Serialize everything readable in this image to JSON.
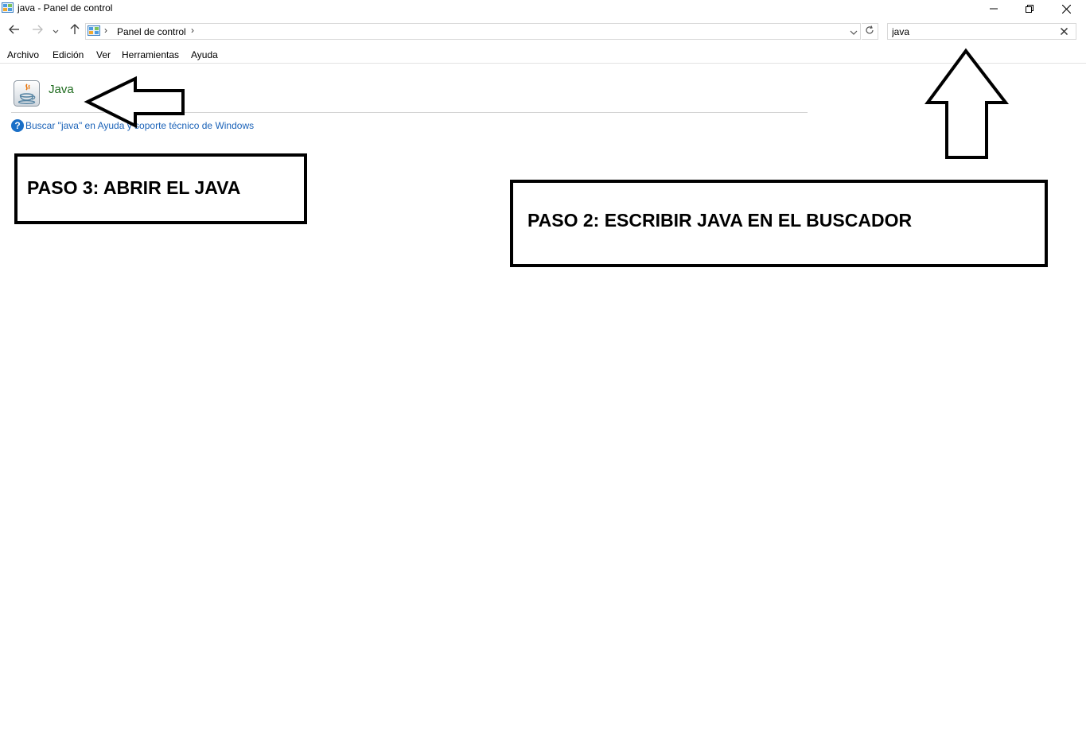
{
  "window": {
    "title": "java - Panel de control",
    "controls": [
      "minimize",
      "restore",
      "close"
    ]
  },
  "navigation": {
    "back_icon": "arrow-left-icon",
    "forward_icon": "arrow-right-icon",
    "recent_icon": "chevron-down-icon",
    "up_icon": "arrow-up-icon",
    "address": {
      "icon": "control-panel-icon",
      "breadcrumb": "Panel de control"
    },
    "refresh_icon": "refresh-icon"
  },
  "search": {
    "value": "java",
    "clear_icon": "close-icon"
  },
  "menu": {
    "items": [
      "Archivo",
      "Edición",
      "Ver",
      "Herramientas",
      "Ayuda"
    ]
  },
  "results": {
    "items": [
      {
        "label": "Java",
        "icon": "java-cup-icon"
      }
    ],
    "help_link": "Buscar \"java\" en Ayuda y soporte técnico de Windows",
    "help_icon": "question-icon"
  },
  "annotations": {
    "step3": "PASO 3: ABRIR EL JAVA",
    "step2": "PASO 2: ESCRIBIR JAVA EN EL BUSCADOR",
    "colors": {
      "stroke": "#000000",
      "fill": "#ffffff"
    }
  },
  "colors": {
    "result_link": "#1e6b1e",
    "help_link": "#1a62b8",
    "border": "#d9d9d9"
  }
}
